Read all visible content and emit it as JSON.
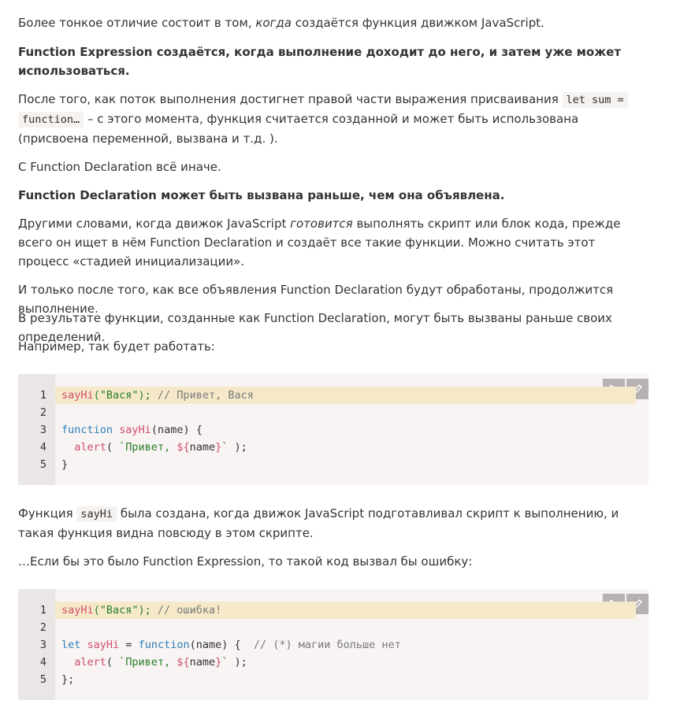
{
  "paragraphs": {
    "p1_a": "Более тонкое отличие состоит в том, ",
    "p1_em": "когда",
    "p1_b": " создаётся функция движком JavaScript.",
    "p2": "Function Expression создаётся, когда выполнение доходит до него, и затем уже может использоваться.",
    "p3_a": "После того, как поток выполнения достигнет правой части выражения присваивания ",
    "p3_code1": "let sum =",
    "p3_code2": "function…",
    "p3_b": " – с этого момента, функция считается созданной и может быть использована (присвоена переменной, вызвана и т.д. ).",
    "p4": "С Function Declaration всё иначе.",
    "p5": "Function Declaration может быть вызвана раньше, чем она объявлена.",
    "p6_a": "Другими словами, когда движок JavaScript ",
    "p6_em": "готовится",
    "p6_b": " выполнять скрипт или блок кода, прежде всего он ищет в нём Function Declaration и создаёт все такие функции. Можно считать этот процесс «стадией инициализации».",
    "p7": "И только после того, как все объявления Function Declaration будут обработаны, продолжится выполнение.",
    "p8": "В результате функции, созданные как Function Declaration, могут быть вызваны раньше своих определений.",
    "p9": "Например, так будет работать:",
    "p10_a": "Функция ",
    "p10_code": "sayHi",
    "p10_b": " была создана, когда движок JavaScript подготавливал скрипт к выполнению, и такая функция видна повсюду в этом скрипте.",
    "p11": "…Если бы это было Function Expression, то такой код вызвал бы ошибку:"
  },
  "code1": {
    "line_numbers": [
      "1",
      "2",
      "3",
      "4",
      "5"
    ],
    "l1_fn": "sayHi",
    "l1_args": "(\"Вася\");",
    "l1_comment": " // Привет, Вася",
    "l3_kw": "function",
    "l3_fn": " sayHi",
    "l3_rest": "(name) {",
    "l4_fn": "  alert",
    "l4_open": "( ",
    "l4_str1": "`Привет, ",
    "l4_interp_open": "${",
    "l4_var": "name",
    "l4_interp_close": "}",
    "l4_str2": "`",
    "l4_close": " );",
    "l5": "}"
  },
  "code2": {
    "line_numbers": [
      "1",
      "2",
      "3",
      "4",
      "5"
    ],
    "l1_fn": "sayHi",
    "l1_args": "(\"Вася\");",
    "l1_comment": " // ошибка!",
    "l3_kw": "let",
    "l3_fn": " sayHi",
    "l3_eq": " = ",
    "l3_kw2": "function",
    "l3_rest": "(name) {  ",
    "l3_comment": "// (*) магии больше нет",
    "l4_fn": "  alert",
    "l4_open": "( ",
    "l4_str1": "`Привет, ",
    "l4_interp_open": "${",
    "l4_var": "name",
    "l4_interp_close": "}",
    "l4_str2": "`",
    "l4_close": " );",
    "l5": "};"
  },
  "icons": {
    "run": "play-icon",
    "edit": "pencil-icon"
  }
}
